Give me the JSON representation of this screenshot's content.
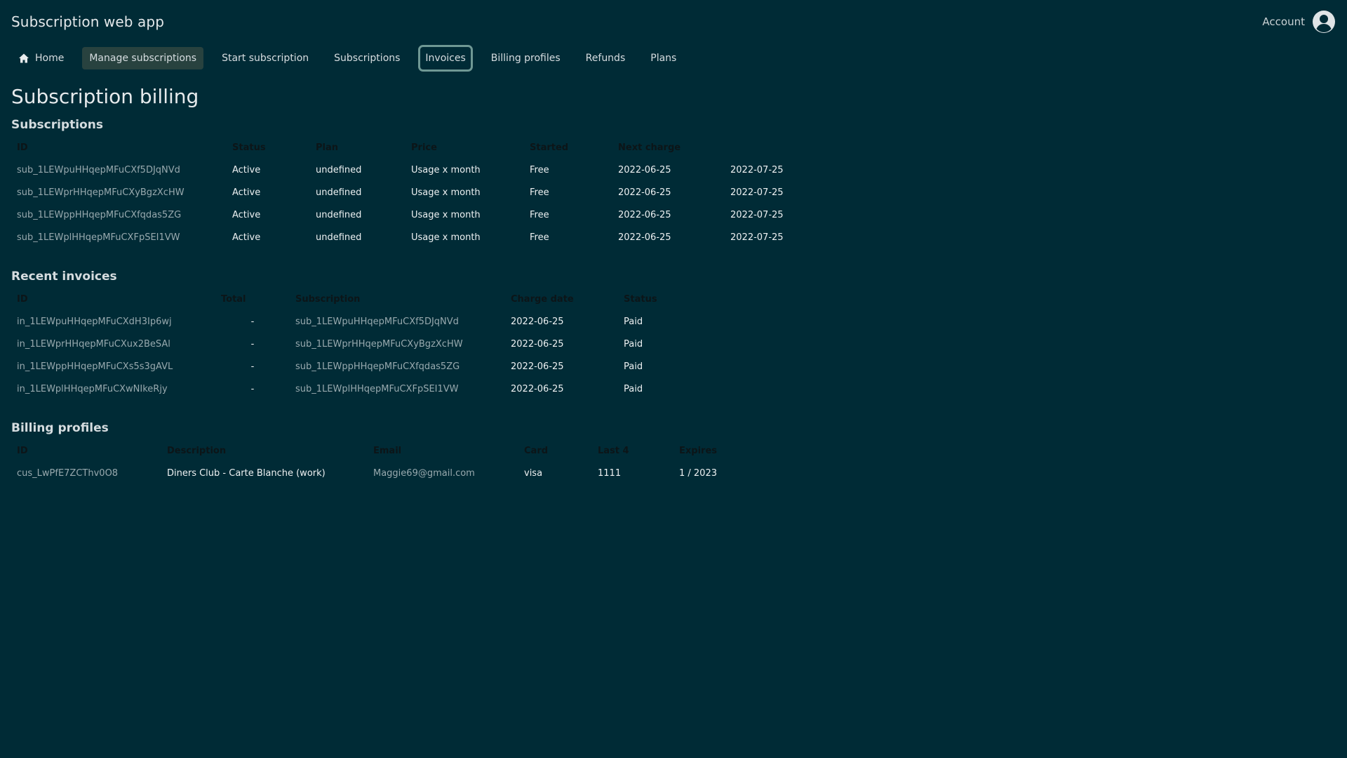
{
  "header": {
    "app_title": "Subscription web app",
    "account_label": "Account",
    "avatar_icon": "user-circle-icon"
  },
  "nav": {
    "home_icon": "home-icon",
    "items": [
      {
        "label": "Home"
      },
      {
        "label": "Manage subscriptions"
      },
      {
        "label": "Start subscription"
      },
      {
        "label": "Subscriptions"
      },
      {
        "label": "Invoices"
      },
      {
        "label": "Billing profiles"
      },
      {
        "label": "Refunds"
      },
      {
        "label": "Plans"
      }
    ]
  },
  "page": {
    "title": "Subscription billing"
  },
  "subscriptions": {
    "title": "Subscriptions",
    "columns": [
      "ID",
      "Status",
      "Plan",
      "Price",
      "Started",
      "Next charge",
      ""
    ],
    "rows": [
      [
        "sub_1LEWpuHHqepMFuCXf5DJqNVd",
        "Active",
        "undefined",
        "Usage x month",
        "Free",
        "2022-06-25",
        "2022-07-25"
      ],
      [
        "sub_1LEWprHHqepMFuCXyBgzXcHW",
        "Active",
        "undefined",
        "Usage x month",
        "Free",
        "2022-06-25",
        "2022-07-25"
      ],
      [
        "sub_1LEWppHHqepMFuCXfqdas5ZG",
        "Active",
        "undefined",
        "Usage x month",
        "Free",
        "2022-06-25",
        "2022-07-25"
      ],
      [
        "sub_1LEWplHHqepMFuCXFpSEI1VW",
        "Active",
        "undefined",
        "Usage x month",
        "Free",
        "2022-06-25",
        "2022-07-25"
      ]
    ]
  },
  "invoices": {
    "title": "Recent invoices",
    "columns": [
      "ID",
      "Total",
      "Subscription",
      "Charge date",
      "Status"
    ],
    "rows": [
      [
        "in_1LEWpuHHqepMFuCXdH3Ip6wj",
        "-",
        "sub_1LEWpuHHqepMFuCXf5DJqNVd",
        "2022-06-25",
        "Paid"
      ],
      [
        "in_1LEWprHHqepMFuCXux2BeSAl",
        "-",
        "sub_1LEWprHHqepMFuCXyBgzXcHW",
        "2022-06-25",
        "Paid"
      ],
      [
        "in_1LEWppHHqepMFuCXs5s3gAVL",
        "-",
        "sub_1LEWppHHqepMFuCXfqdas5ZG",
        "2022-06-25",
        "Paid"
      ],
      [
        "in_1LEWplHHqepMFuCXwNIkeRjy",
        "-",
        "sub_1LEWplHHqepMFuCXFpSEI1VW",
        "2022-06-25",
        "Paid"
      ]
    ]
  },
  "billing_profiles": {
    "title": "Billing profiles",
    "columns": [
      "ID",
      "Description",
      "Email",
      "Card",
      "Last 4",
      "Expires"
    ],
    "rows": [
      [
        "cus_LwPfE7ZCThv0O8",
        "Diners Club - Carte Blanche (work)",
        "Maggie69@gmail.com",
        "visa",
        "1111",
        "1 / 2023"
      ]
    ]
  },
  "colors": {
    "background": "#002b36",
    "nav_active_bg": "#28423f",
    "focus_ring": "#6f9894",
    "link_text": "#98a9ae"
  }
}
